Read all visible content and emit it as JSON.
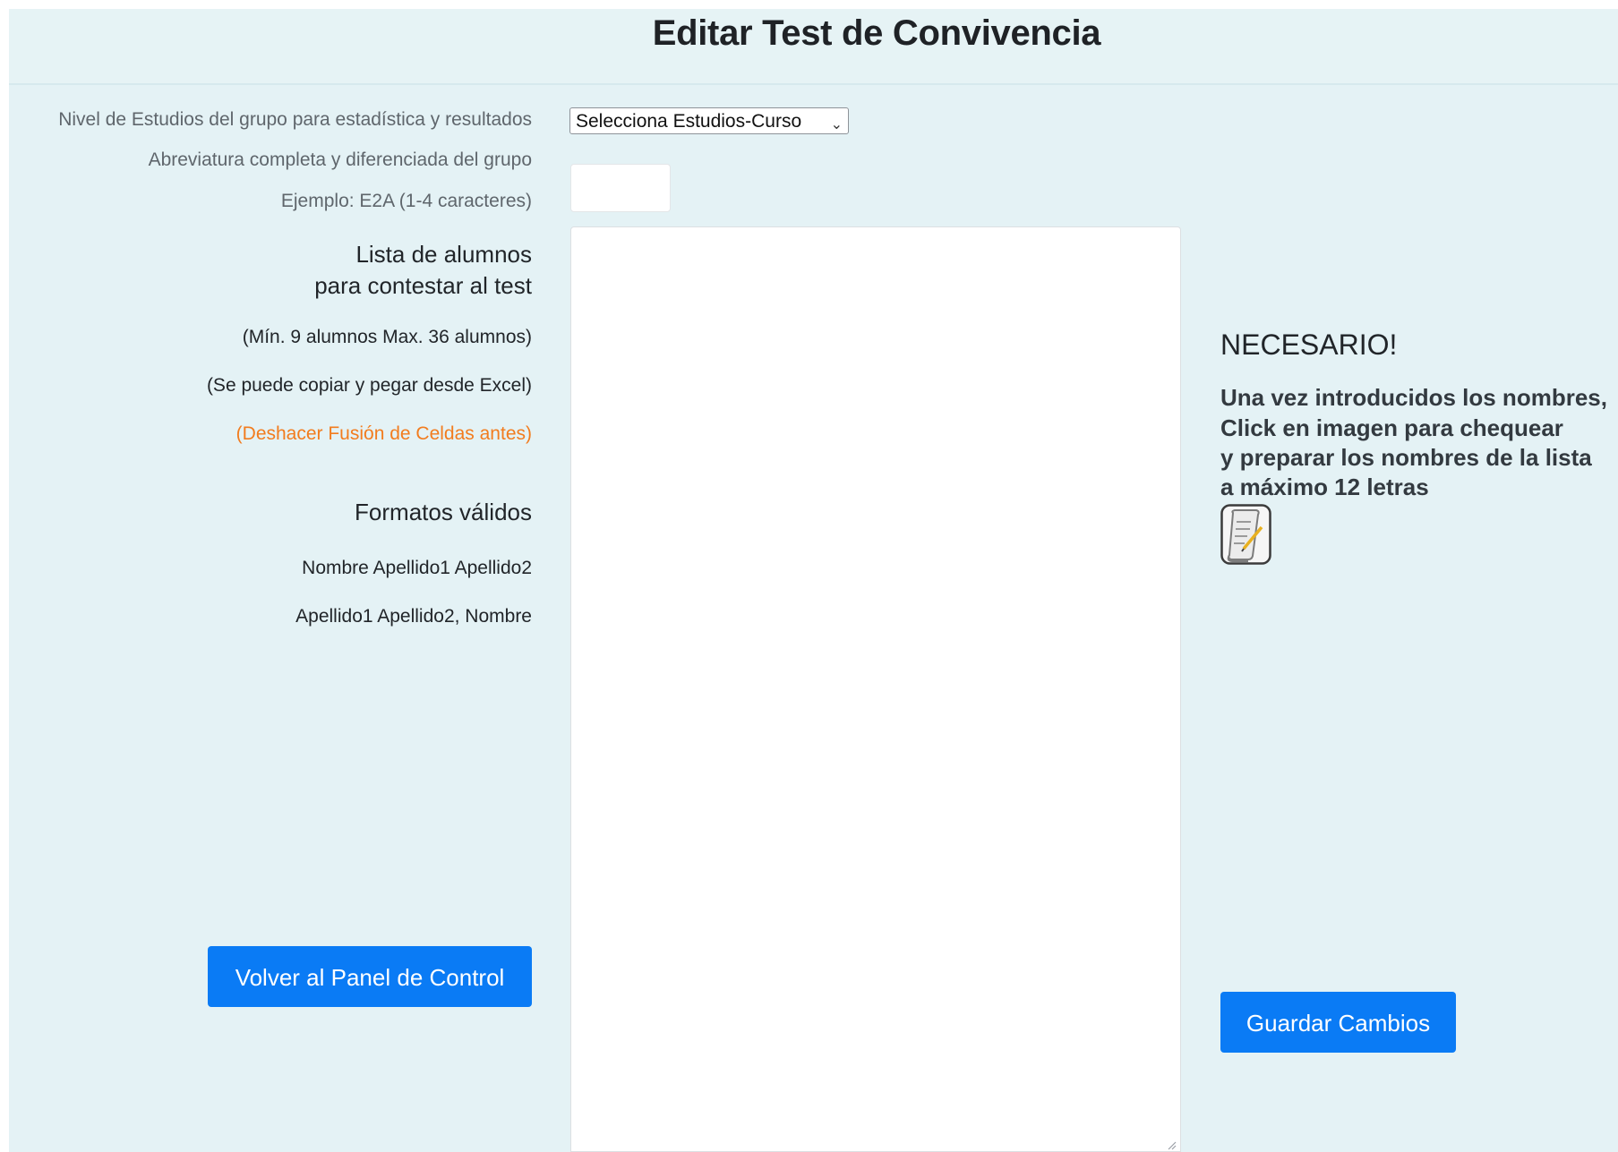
{
  "header": {
    "title": "Editar Test de Convivencia"
  },
  "form": {
    "level_label": "Nivel de Estudios del grupo para estadística y resultados",
    "level_select_value": "Selecciona Estudios-Curso",
    "abbr_label_line1": "Abreviatura completa y diferenciada del grupo",
    "abbr_label_line2": "Ejemplo: E2A (1-4 caracteres)",
    "abbr_value": "",
    "list_heading_line1": "Lista de alumnos",
    "list_heading_line2": "para contestar al test",
    "list_hint_count": "(Mín. 9 alumnos Max. 36 alumnos)",
    "list_hint_excel": "(Se puede copiar y pegar desde Excel)",
    "list_hint_merge": "(Deshacer Fusión de Celdas antes)",
    "formats_heading": "Formatos válidos",
    "format_1": "Nombre Apellido1 Apellido2",
    "format_2": "Apellido1 Apellido2, Nombre",
    "names_value": ""
  },
  "side": {
    "heading": "NECESARIO!",
    "line1": "Una vez introducidos los nombres,",
    "line2": "Click en imagen para chequear",
    "line3": "y preparar los nombres de la lista",
    "line4": "a máximo 12 letras",
    "icon": "scroll-check-icon"
  },
  "buttons": {
    "back_label": "Volver al Panel de Control",
    "save_label": "Guardar Cambios"
  },
  "colors": {
    "background": "#e4f2f5",
    "primary_button": "#0a7bf5",
    "warning_text": "#f27c1e"
  }
}
